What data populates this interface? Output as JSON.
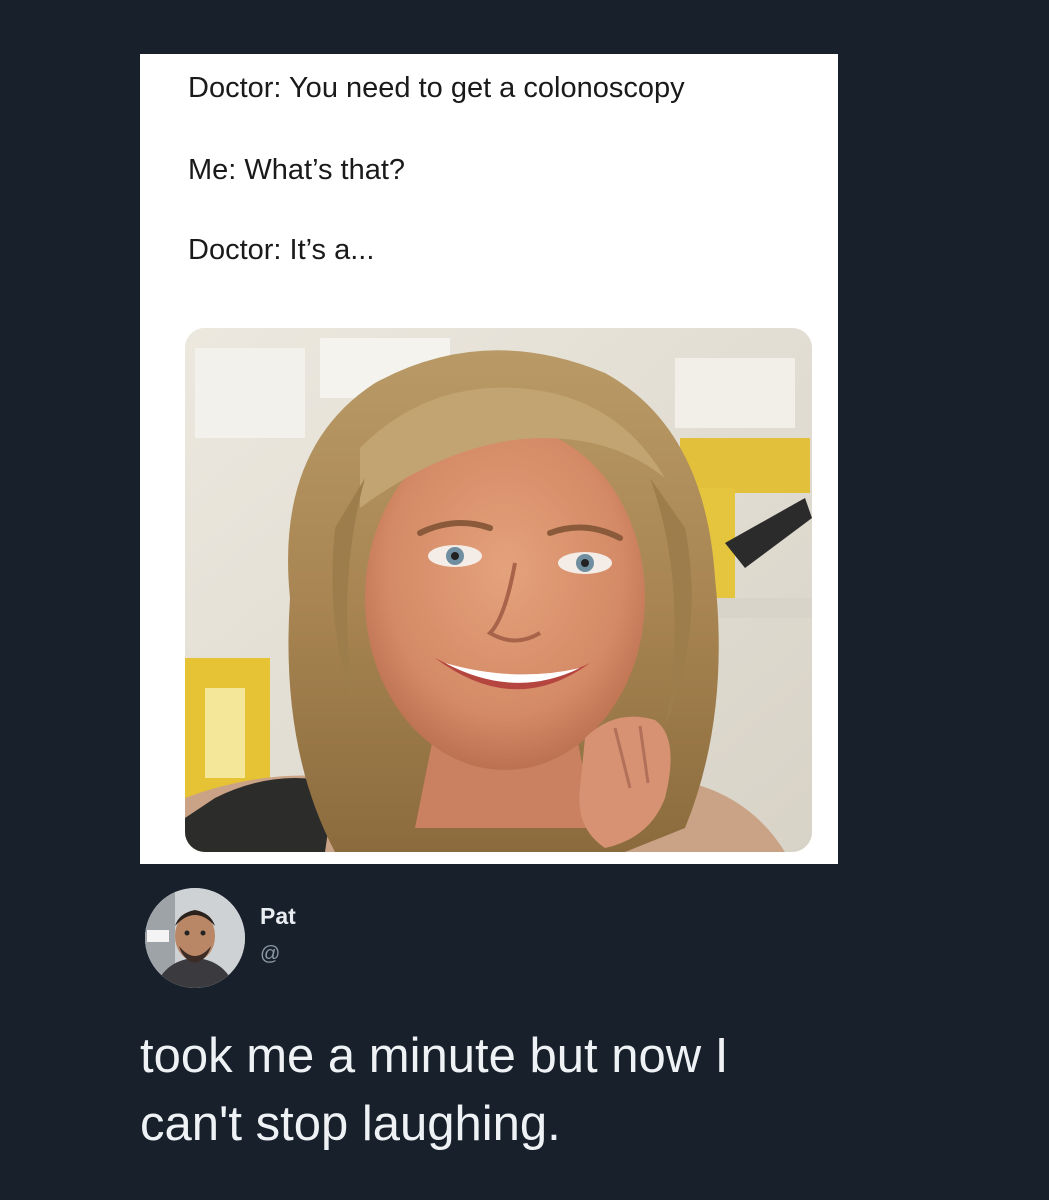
{
  "quoted_post": {
    "lines": [
      "Doctor: You need to get a colonoscopy",
      "Me: What’s that?",
      "Doctor: It’s a..."
    ],
    "image_icon": "photo-of-smiling-woman"
  },
  "author": {
    "name": "Pat",
    "handle": "@",
    "avatar_icon": "profile-photo"
  },
  "tweet": {
    "lines": [
      "took me a minute but now I",
      "can't stop laughing."
    ]
  },
  "colors": {
    "background": "#17202b",
    "card": "#ffffff",
    "text": "#eef2f5",
    "secondary_text": "#8b98a5"
  }
}
